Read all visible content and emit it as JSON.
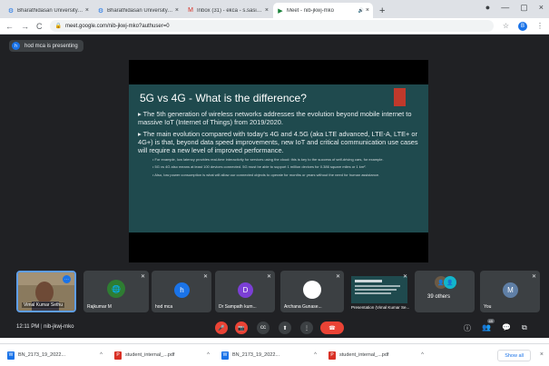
{
  "browser": {
    "tabs": [
      {
        "title": "Bharathidasan University, Tiruchi",
        "icon": "university-favicon",
        "active": false
      },
      {
        "title": "Bharathidasan University, Tiruc",
        "icon": "university-favicon",
        "active": false
      },
      {
        "title": "Inbox (31) - ekca - s.sasiPurna",
        "icon": "gmail-favicon",
        "active": false
      },
      {
        "title": "Meet - nib-jkwj-mko",
        "icon": "meet-favicon",
        "active": true
      }
    ],
    "tab_close": "×",
    "audio_icon": "🔊",
    "new_tab": "+",
    "window": {
      "cast": "●",
      "minimize": "—",
      "maximize": "▢",
      "close": "×"
    },
    "nav": {
      "back": "←",
      "forward": "→",
      "reload": "C"
    },
    "url": "meet.google.com/nib-jkwj-mko?authuser=0",
    "star": "☆",
    "profile_initial": "B",
    "menu": "⋮"
  },
  "meet": {
    "presenter_initial": "h",
    "presenting_label": "hod mca is presenting",
    "slide": {
      "title": "5G vs 4G - What is the difference?",
      "bullets": [
        "The 5th generation of wireless networks addresses the evolution beyond mobile internet to massive IoT (Internet of Things) from 2019/2020.",
        "The main evolution compared with today's 4G and 4.5G (aka LTE advanced, LTE-A, LTE+ or 4G+) is that, beyond data speed improvements, new IoT and critical communication use cases will require a new level of improved performance."
      ],
      "subbullets": [
        "For example, low latency provides real-time interactivity for services using the cloud: this is key to the success of self-driving cars, for example.",
        "5G vs 4G also means at least 100 devices connected. 5G must be able to support 1 million devices for 0.386 square miles or 1 km².",
        "Also, low power consumption is what will allow our connected objects to operate for months or years without the need for human assistance."
      ]
    },
    "participants": [
      {
        "name": "Vimal Kumar Sethu",
        "kind": "video"
      },
      {
        "name": "Rajkumar M",
        "kind": "photo"
      },
      {
        "name": "hod mca",
        "initial": "h",
        "color": "#1a73e8"
      },
      {
        "name": "Dr Sampath kum...",
        "initial": "D",
        "color": "#7b3fd6"
      },
      {
        "name": "Archana Gunase...",
        "kind": "white-circle"
      },
      {
        "name": "Presentation (Vimal Kumar Se...",
        "kind": "screen"
      },
      {
        "name": "",
        "others": "39 others"
      },
      {
        "name": "You",
        "initial": "M",
        "color": "#5f7fa6"
      }
    ],
    "mic_off_icon": "✕",
    "more_options": "⋯",
    "time": "12:11 PM",
    "separator": "|",
    "meeting_code": "nib-jkwj-mko",
    "controls": {
      "mic": "🎤",
      "camera": "📷",
      "captions": "cc",
      "present": "⬆",
      "more": "⋮",
      "end_call": "☎"
    },
    "right": {
      "info": "ⓘ",
      "people": "👥",
      "people_badge": "49",
      "chat": "💬",
      "activities": "⧉"
    }
  },
  "downloads": [
    {
      "name": "BN_2173_19_2022...",
      "color": "#1a73e8",
      "icon": "W"
    },
    {
      "name": "student_internal_...pdf",
      "color": "#d93025",
      "icon": "P"
    },
    {
      "name": "BN_2173_19_2022...",
      "color": "#1a73e8",
      "icon": "W"
    },
    {
      "name": "student_internal_...pdf",
      "color": "#d93025",
      "icon": "P"
    }
  ],
  "download_chevron": "^",
  "show_all": "Show all",
  "close": "×"
}
